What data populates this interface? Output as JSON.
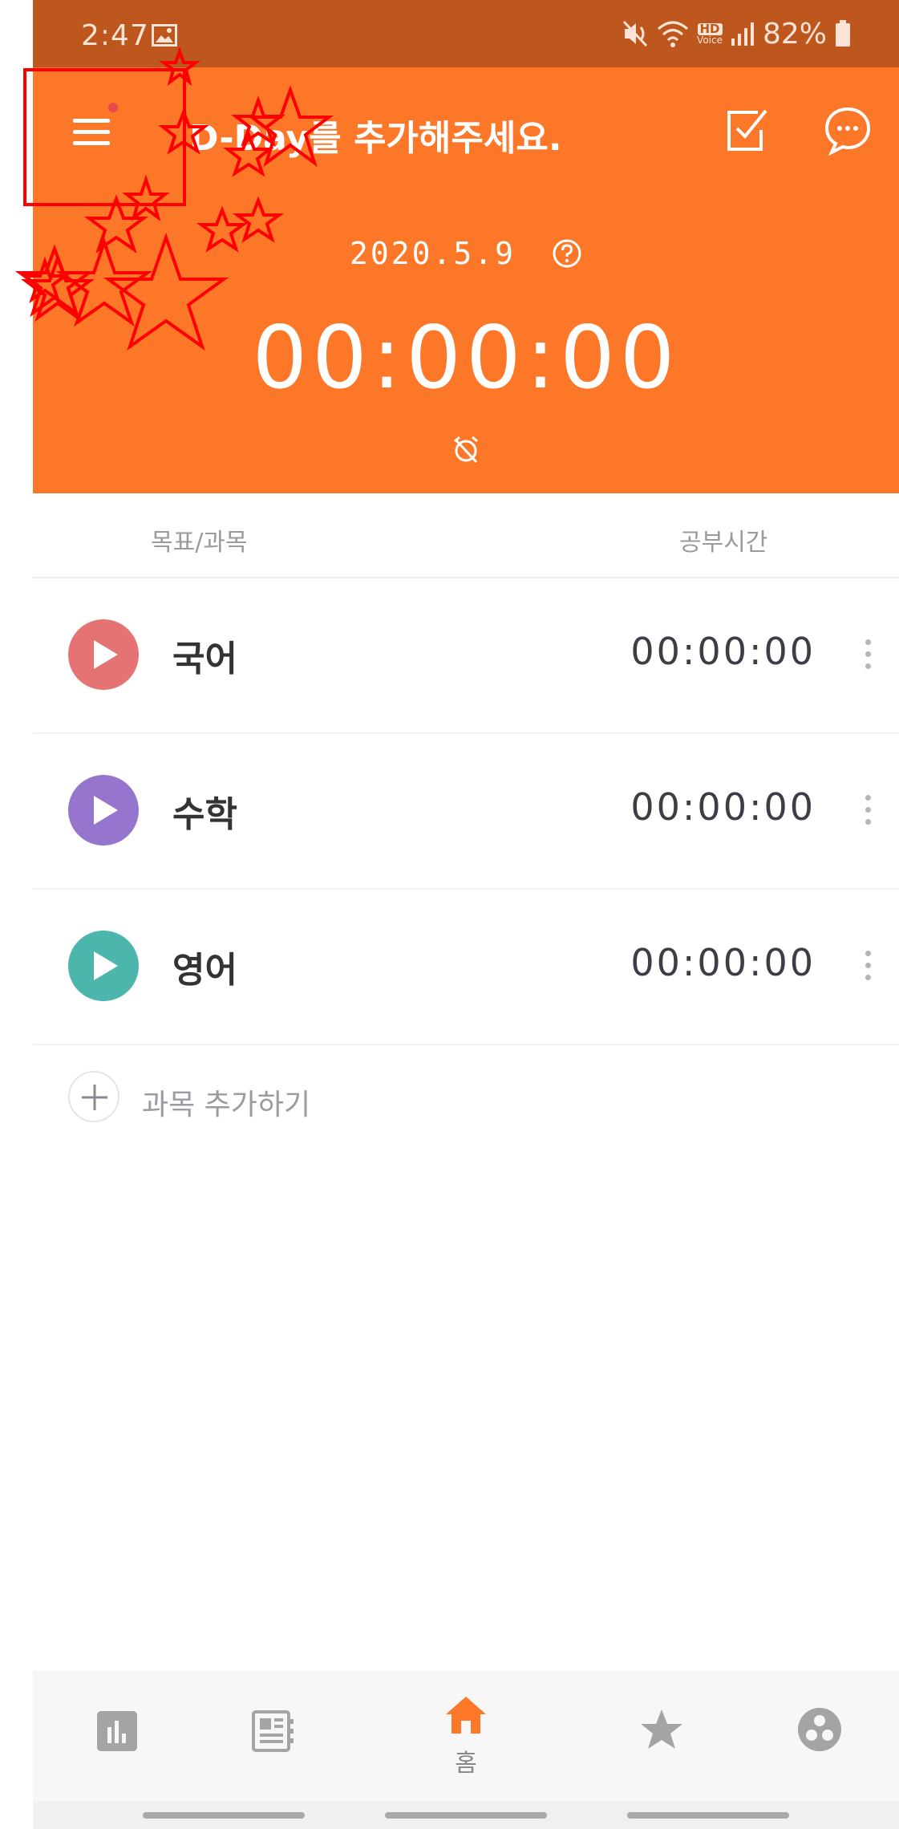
{
  "status_bar": {
    "time": "2:47",
    "battery": "82%",
    "hd_label": "HD",
    "voice_label": "Voice"
  },
  "header": {
    "title": "D-Day를 추가해주세요.",
    "date": "2020.5.9",
    "timer": "00:00:00",
    "background_color": "#fc7727"
  },
  "columns": {
    "subject": "목표/과목",
    "study_time": "공부시간"
  },
  "subjects": [
    {
      "name": "국어",
      "time": "00:00:00",
      "color": "#e57373"
    },
    {
      "name": "수학",
      "time": "00:00:00",
      "color": "#9575cd"
    },
    {
      "name": "영어",
      "time": "00:00:00",
      "color": "#4db6ac"
    }
  ],
  "add_subject": {
    "label": "과목 추가하기"
  },
  "bottom_nav": {
    "home_label": "홈",
    "active_color": "#fc7727",
    "icons": [
      "stats-icon",
      "planner-icon",
      "home-icon",
      "star-icon",
      "group-icon"
    ]
  }
}
